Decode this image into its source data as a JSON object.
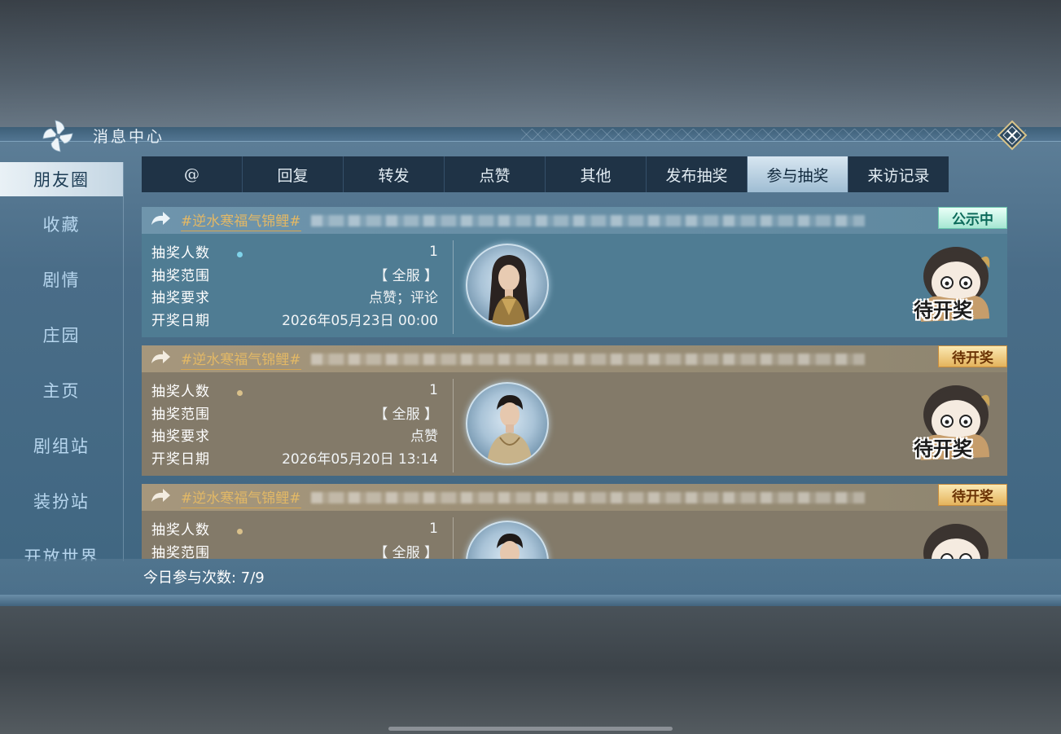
{
  "window": {
    "title": "消息中心"
  },
  "sidebar": {
    "items": [
      {
        "label": "朋友圈",
        "active": true
      },
      {
        "label": "收藏"
      },
      {
        "label": "剧情"
      },
      {
        "label": "庄园"
      },
      {
        "label": "主页"
      },
      {
        "label": "剧组站"
      },
      {
        "label": "装扮站"
      },
      {
        "label": "开放世界"
      }
    ]
  },
  "tabs": [
    {
      "label": "@"
    },
    {
      "label": "回复"
    },
    {
      "label": "转发"
    },
    {
      "label": "点赞"
    },
    {
      "label": "其他"
    },
    {
      "label": "发布抽奖"
    },
    {
      "label": "参与抽奖",
      "active": true
    },
    {
      "label": "来访记录"
    }
  ],
  "field_labels": {
    "count": "抽奖人数",
    "scope": "抽奖范围",
    "requirement": "抽奖要求",
    "date": "开奖日期"
  },
  "cards": [
    {
      "theme": "blue",
      "topic": "#逆水寒福气锦鲤#",
      "status": "公示中",
      "count": "1",
      "scope": "【 全服 】",
      "requirement": "点赞；评论",
      "date": "2026年05月23日 00:00",
      "mascot_text": "待开奖"
    },
    {
      "theme": "tan",
      "topic": "#逆水寒福气锦鲤#",
      "status": "待开奖",
      "count": "1",
      "scope": "【 全服 】",
      "requirement": "点赞",
      "date": "2026年05月20日 13:14",
      "mascot_text": "待开奖"
    },
    {
      "theme": "tan",
      "topic": "#逆水寒福气锦鲤#",
      "status": "待开奖",
      "count": "1",
      "scope": "【 全服 】",
      "requirement": "",
      "date": "",
      "mascot_text": ""
    }
  ],
  "footer": {
    "daily_label": "今日参与次数: 7/9"
  }
}
